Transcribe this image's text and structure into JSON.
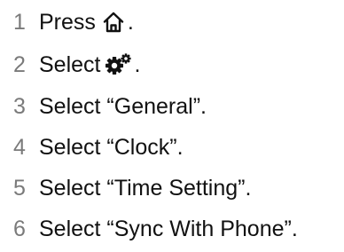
{
  "steps": [
    {
      "number": "1",
      "text": "Press",
      "icon": "home-icon",
      "suffix": "."
    },
    {
      "number": "2",
      "text": "Select",
      "icon": "settings-gears-icon",
      "suffix": "."
    },
    {
      "number": "3",
      "text": "Select “General”."
    },
    {
      "number": "4",
      "text": "Select “Clock”."
    },
    {
      "number": "5",
      "text": "Select “Time Setting”."
    },
    {
      "number": "6",
      "text": "Select “Sync With Phone”."
    }
  ]
}
